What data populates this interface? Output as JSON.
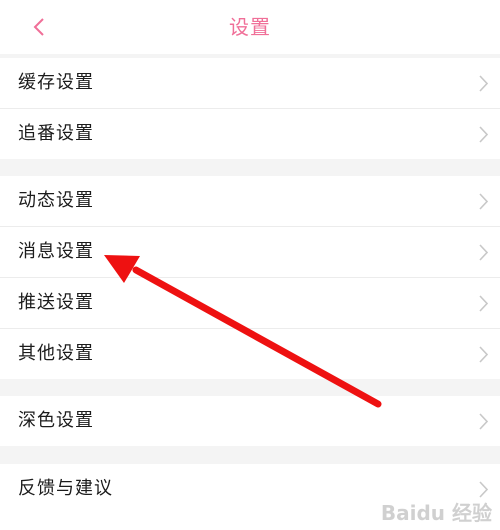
{
  "header": {
    "title": "设置"
  },
  "groups": [
    {
      "items": [
        {
          "label": "缓存设置"
        },
        {
          "label": "追番设置"
        }
      ]
    },
    {
      "items": [
        {
          "label": "动态设置"
        },
        {
          "label": "消息设置"
        },
        {
          "label": "推送设置"
        },
        {
          "label": "其他设置"
        }
      ]
    },
    {
      "items": [
        {
          "label": "深色设置"
        }
      ]
    },
    {
      "items": [
        {
          "label": "反馈与建议"
        }
      ]
    }
  ],
  "watermark": "Baidu 经验",
  "colors": {
    "accent": "#f06f98",
    "annotation_arrow": "#ee1111",
    "chevron": "#c8c8c8"
  },
  "icons": {
    "back": "chevron-left-icon",
    "row_indicator": "chevron-right-icon"
  }
}
